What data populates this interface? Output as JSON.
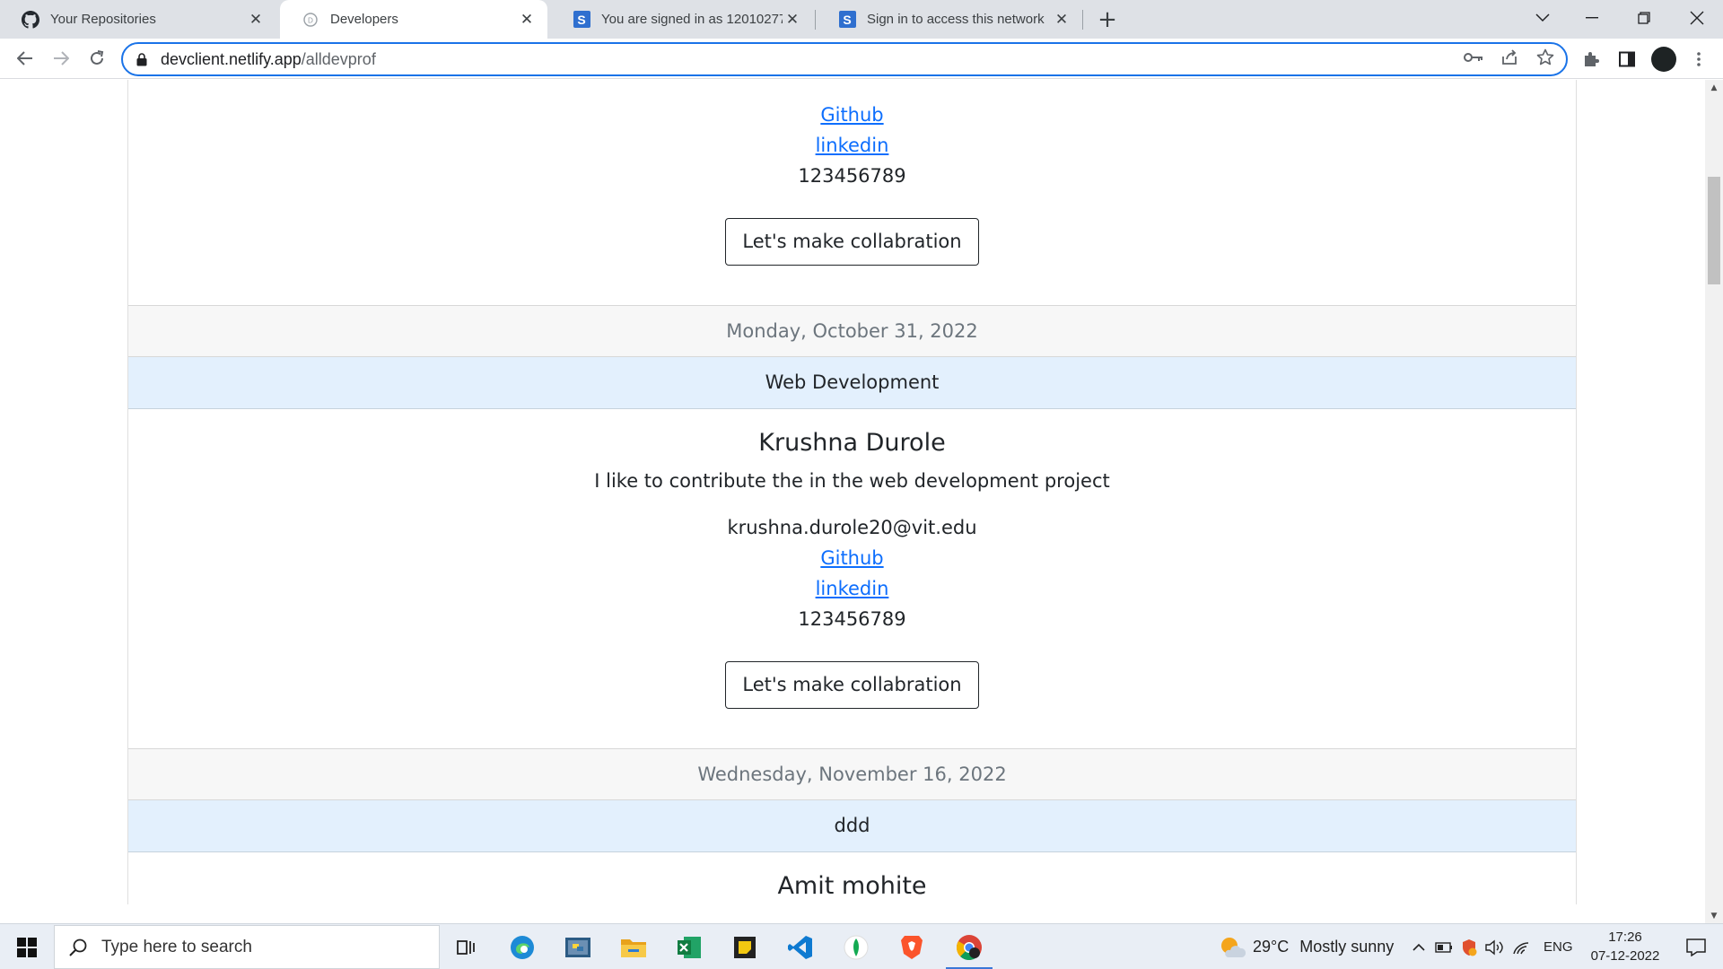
{
  "browser": {
    "tabs": [
      {
        "title": "Your Repositories",
        "icon": "github-icon",
        "active": false
      },
      {
        "title": "Developers",
        "icon": "developers-favicon-icon",
        "active": true
      },
      {
        "title": "You are signed in as 12010277",
        "icon": "s-favicon-icon",
        "active": false
      },
      {
        "title": "Sign in to access this network",
        "icon": "s-favicon-icon",
        "active": false
      }
    ],
    "url_host": "devclient.netlify.app",
    "url_path": "/alldevprof"
  },
  "page": {
    "partial_card": {
      "github": "Github",
      "linkedin": "linkedin",
      "phone": "123456789",
      "button": "Let's make collabration",
      "date": "Monday, October 31, 2022"
    },
    "card": {
      "header": "Web Development",
      "name": "Krushna Durole",
      "description": "I like to contribute the in the web development project",
      "email": "krushna.durole20@vit.edu",
      "github": "Github",
      "linkedin": "linkedin",
      "phone": "123456789",
      "button": "Let's make collabration",
      "date": "Wednesday, November 16, 2022"
    },
    "next_card": {
      "header": "ddd",
      "name": "Amit mohite"
    }
  },
  "taskbar": {
    "search_placeholder": "Type here to search",
    "weather_temp": "29°C",
    "weather_text": "Mostly sunny",
    "language": "ENG",
    "time": "17:26",
    "date": "07-12-2022"
  },
  "colors": {
    "link": "#0d6efd",
    "card_header_bg": "#e3f0fd",
    "card_footer_bg": "#f7f7f7",
    "omnibox_focus": "#1a73e8"
  }
}
